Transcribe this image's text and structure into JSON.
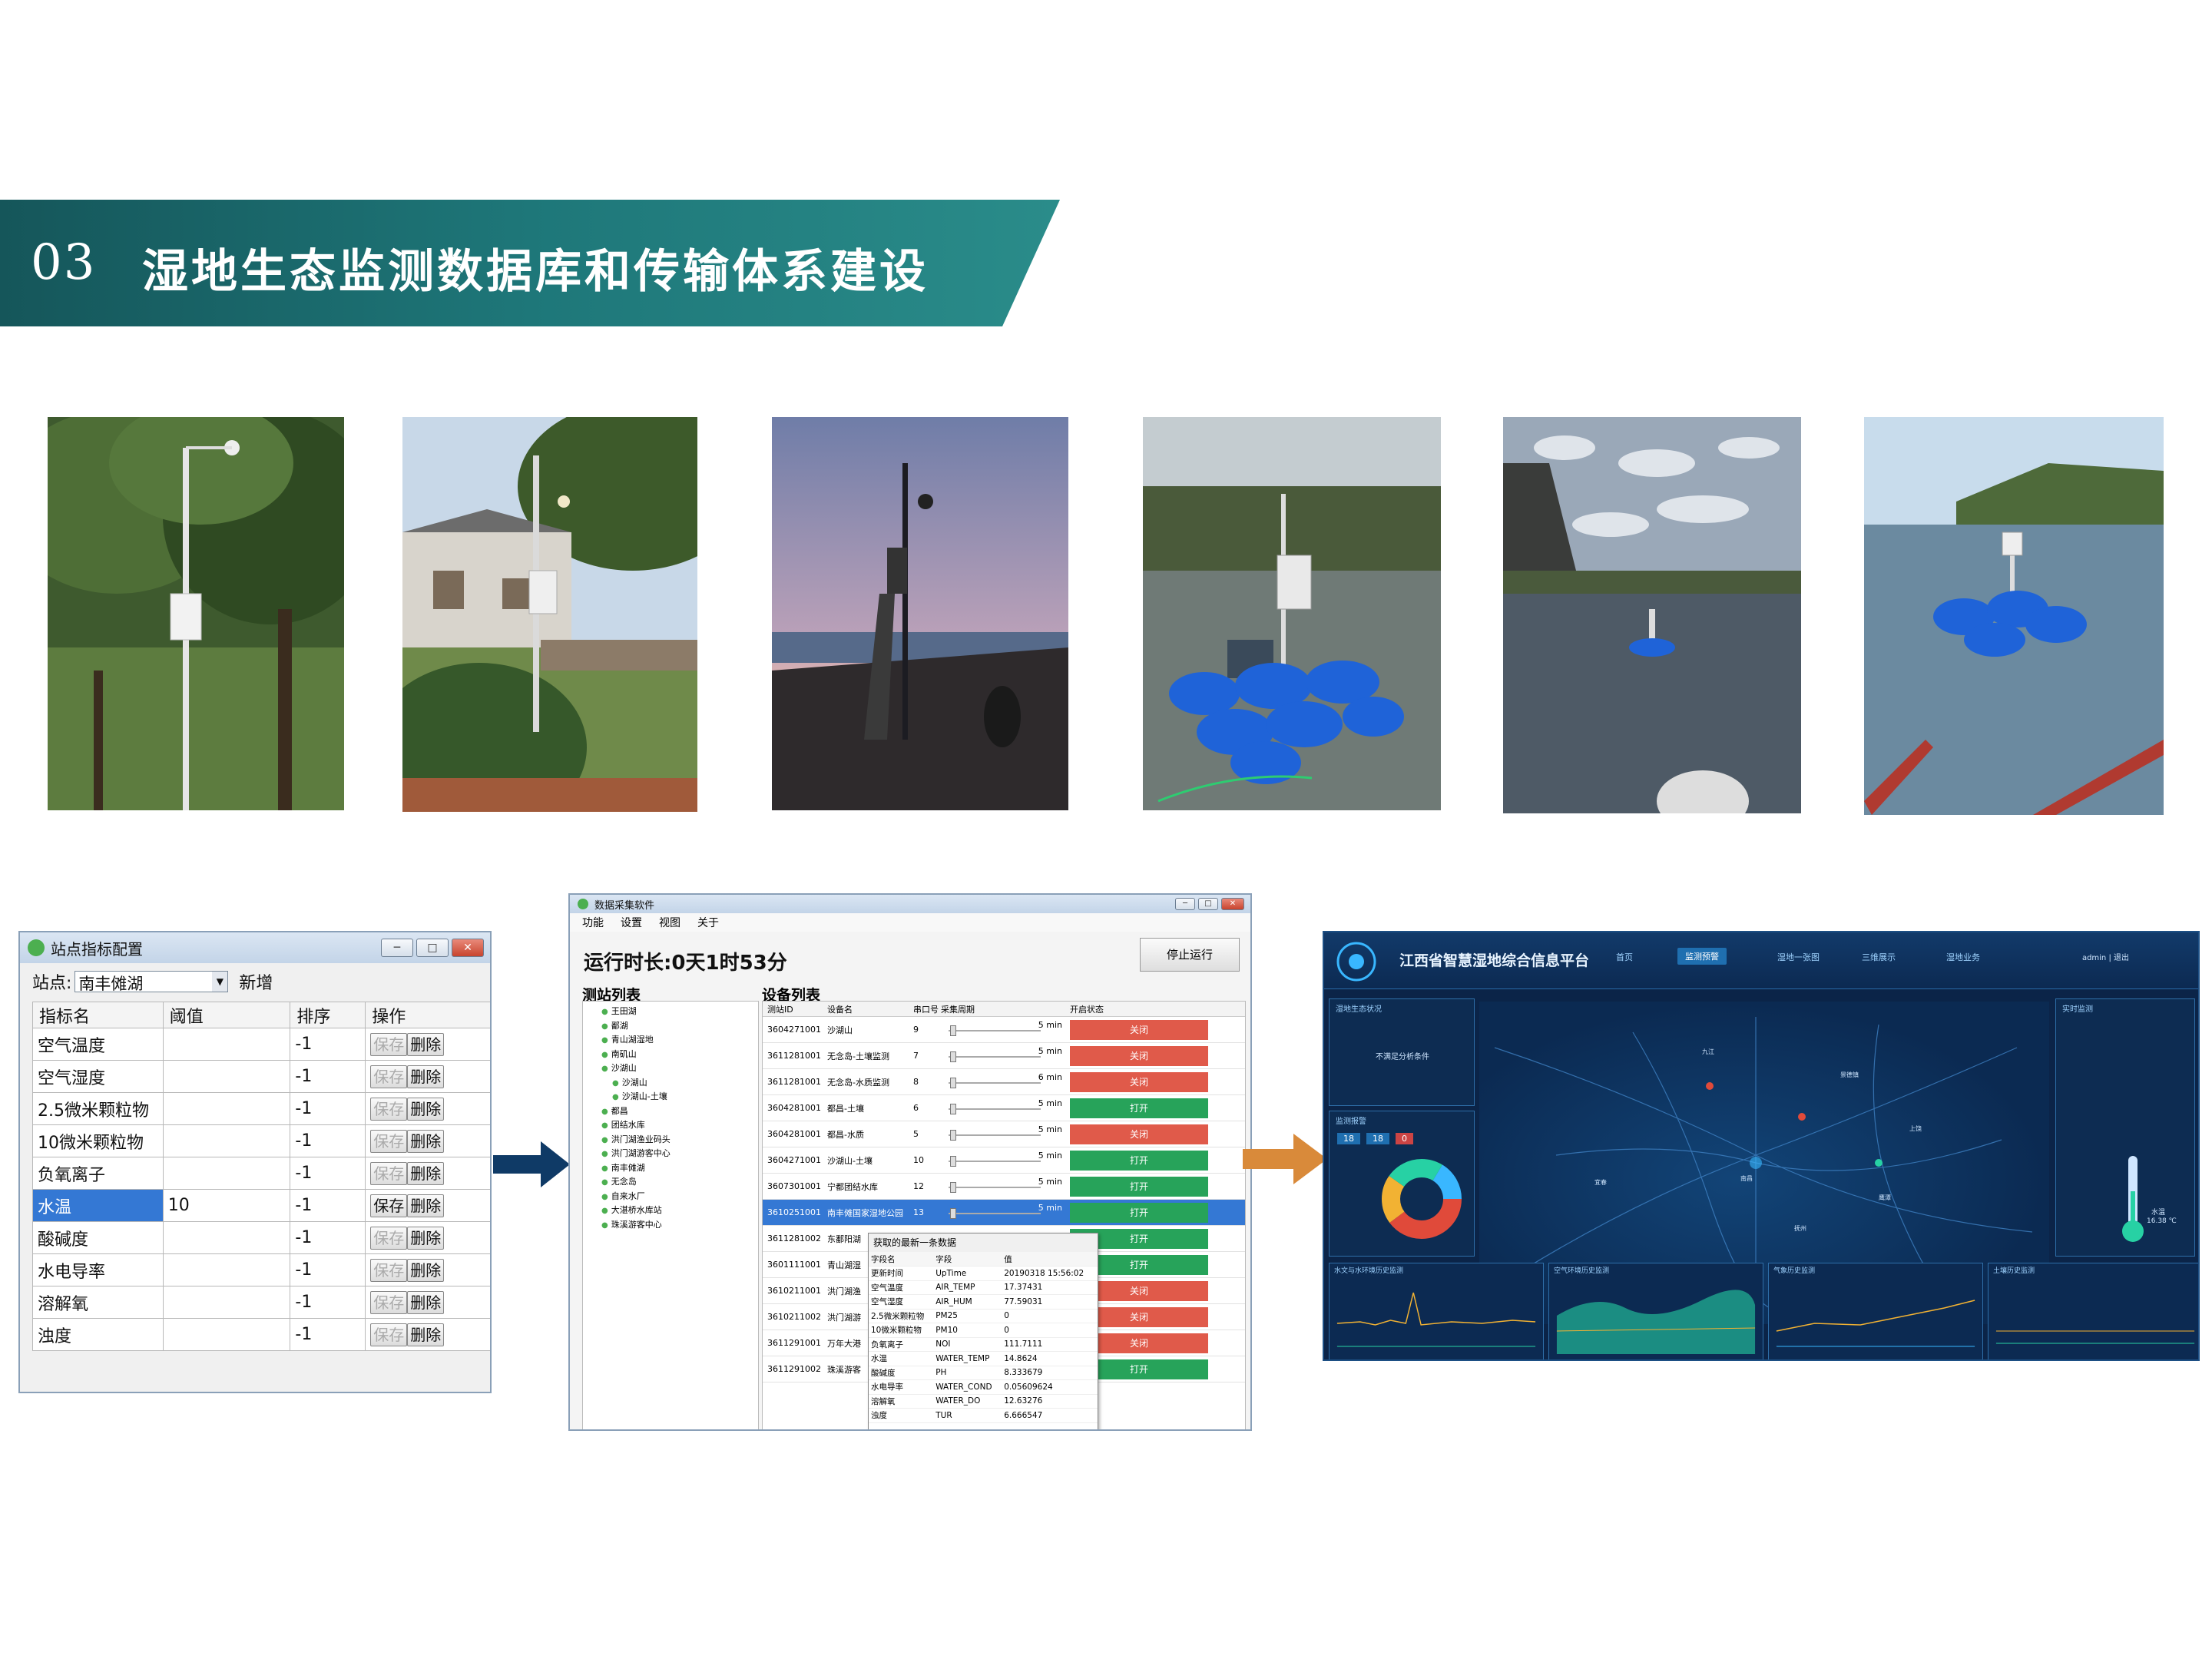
{
  "header": {
    "number": "03",
    "title": "湿地生态监测数据库和传输体系建设"
  },
  "photos": [
    {
      "name": "photo-tree-station"
    },
    {
      "name": "photo-village-station"
    },
    {
      "name": "photo-dusk-install"
    },
    {
      "name": "photo-floating-station-close"
    },
    {
      "name": "photo-lake-buoy"
    },
    {
      "name": "photo-lake-platform"
    }
  ],
  "config_window": {
    "title": "站点指标配置",
    "site_label": "站点:",
    "site_value": "南丰傩湖",
    "add_label": "新增",
    "columns": [
      "指标名",
      "阈值",
      "排序",
      "操作"
    ],
    "rows": [
      {
        "name": "空气温度",
        "threshold": "",
        "order": "-1"
      },
      {
        "name": "空气湿度",
        "threshold": "",
        "order": "-1"
      },
      {
        "name": "2.5微米颗粒物",
        "threshold": "",
        "order": "-1"
      },
      {
        "name": "10微米颗粒物",
        "threshold": "",
        "order": "-1"
      },
      {
        "name": "负氧离子",
        "threshold": "",
        "order": "-1"
      },
      {
        "name": "水温",
        "threshold": "10",
        "order": "-1",
        "selected": true
      },
      {
        "name": "酸碱度",
        "threshold": "",
        "order": "-1"
      },
      {
        "name": "水电导率",
        "threshold": "",
        "order": "-1"
      },
      {
        "name": "溶解氧",
        "threshold": "",
        "order": "-1"
      },
      {
        "name": "浊度",
        "threshold": "",
        "order": "-1"
      }
    ],
    "save_label": "保存",
    "delete_label": "删除"
  },
  "collector_window": {
    "title": "数据采集软件",
    "menu": [
      "功能",
      "设置",
      "视图",
      "关于"
    ],
    "runtime": "运行时长:0天1时53分",
    "stop_label": "停止运行",
    "tree_header": "测站列表",
    "device_header": "设备列表",
    "tree": [
      "王田湖",
      "鄱湖",
      "青山湖湿地",
      "南矶山",
      "沙湖山",
      "沙湖山",
      "沙湖山-土壤",
      "都昌",
      "团结水库",
      "洪门湖渔业码头",
      "洪门湖游客中心",
      "南丰傩湖",
      "无念岛",
      "自来水厂",
      "大湛桥水库站",
      "珠溪游客中心"
    ],
    "device_columns": [
      "测站ID",
      "设备名",
      "串口号",
      "采集周期",
      "开启状态"
    ],
    "devices": [
      {
        "id": "3604271001",
        "name": "沙湖山",
        "port": "9",
        "period": "5 min",
        "state": "关闭"
      },
      {
        "id": "3611281001",
        "name": "无念岛-土壤监测",
        "port": "7",
        "period": "5 min",
        "state": "关闭"
      },
      {
        "id": "3611281001",
        "name": "无念岛-水质监测",
        "port": "8",
        "period": "6 min",
        "state": "关闭"
      },
      {
        "id": "3604281001",
        "name": "都昌-土壤",
        "port": "6",
        "period": "5 min",
        "state": "打开"
      },
      {
        "id": "3604281001",
        "name": "都昌-水质",
        "port": "5",
        "period": "5 min",
        "state": "关闭"
      },
      {
        "id": "3604271001",
        "name": "沙湖山-土壤",
        "port": "10",
        "period": "5 min",
        "state": "打开"
      },
      {
        "id": "3607301001",
        "name": "宁都团结水库",
        "port": "12",
        "period": "5 min",
        "state": "打开"
      },
      {
        "id": "3610251001",
        "name": "南丰傩国家湿地公园",
        "port": "13",
        "period": "5 min",
        "state": "打开",
        "selected": true
      },
      {
        "id": "3611281002",
        "name": "东鄱阳湖",
        "port": "",
        "period": "",
        "state": "打开"
      },
      {
        "id": "3601111001",
        "name": "青山湖湿",
        "port": "",
        "period": "",
        "state": "打开"
      },
      {
        "id": "3610211001",
        "name": "洪门湖渔",
        "port": "",
        "period": "",
        "state": "关闭"
      },
      {
        "id": "3610211002",
        "name": "洪门湖游",
        "port": "",
        "period": "",
        "state": "关闭"
      },
      {
        "id": "3611291001",
        "name": "万年大港",
        "port": "",
        "period": "",
        "state": "关闭"
      },
      {
        "id": "3611291002",
        "name": "珠溪游客",
        "port": "",
        "period": "",
        "state": "打开"
      }
    ],
    "popup": {
      "title": "获取的最新一条数据",
      "columns": [
        "字段名",
        "字段",
        "值"
      ],
      "rows": [
        [
          "更新时间",
          "UpTime",
          "20190318 15:56:02"
        ],
        [
          "空气温度",
          "AIR_TEMP",
          "17.37431"
        ],
        [
          "空气湿度",
          "AIR_HUM",
          "77.59031"
        ],
        [
          "2.5微米颗粒物",
          "PM25",
          "0"
        ],
        [
          "10微米颗粒物",
          "PM10",
          "0"
        ],
        [
          "负氧离子",
          "NOI",
          "111.7111"
        ],
        [
          "水温",
          "WATER_TEMP",
          "14.8624"
        ],
        [
          "酸碱度",
          "PH",
          "8.333679"
        ],
        [
          "水电导率",
          "WATER_COND",
          "0.05609624"
        ],
        [
          "溶解氧",
          "WATER_DO",
          "12.63276"
        ],
        [
          "浊度",
          "TUR",
          "6.666547"
        ]
      ]
    }
  },
  "dashboard": {
    "title": "江西省智慧湿地综合信息平台",
    "nav": [
      "首页",
      "监测预警",
      "湿地一张图",
      "三维展示",
      "湿地业务"
    ],
    "active_nav": "监测预警",
    "user": "admin | 退出",
    "left_panel_title": "湿地生态状况",
    "left_panel_text": "不满足分析条件",
    "alarm_title": "监测报警",
    "counts": [
      "18",
      "18",
      "0"
    ],
    "right_panel_title": "实时监测",
    "thermo_label": "水温",
    "thermo_value": "16.38 ℃",
    "mini_titles": [
      "水文与水环境历史监测",
      "空气环境历史监测",
      "气象历史监测",
      "土壤历史监测"
    ],
    "map_labels": [
      "南昌",
      "九江",
      "上饶",
      "景德镇",
      "抚州",
      "宜春",
      "鹰潭"
    ],
    "colors": {
      "bg": "#0b2448",
      "accent": "#39b7ff",
      "chart_line": "#f2b233",
      "chart_fill": "#27d1a4"
    }
  }
}
